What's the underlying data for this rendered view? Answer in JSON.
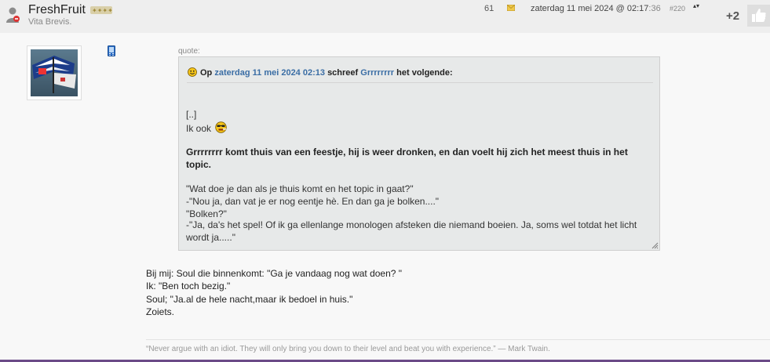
{
  "post_header": {
    "username": "FreshFruit",
    "user_title": "Vita Brevis.",
    "post_count": "61",
    "datetime": "zaterdag 11 mei 2024 @ 02:17",
    "datetime_seconds": ":36",
    "post_number": "#220",
    "score": "+2",
    "icons": {
      "user": "user-status-icon",
      "rank": "rank-stars-icon",
      "mail": "envelope-icon",
      "sort": "updown-arrows-icon",
      "like": "thumbs-up-icon"
    }
  },
  "sidebar": {
    "avatar": "avatar-flag-image",
    "device_icon": "mobile-phone-icon"
  },
  "quote": {
    "label": "quote:",
    "head_prefix": "Op",
    "head_date": "zaterdag 11 mei 2024 02:13",
    "head_middle": "schreef",
    "head_author": "Grrrrrrrr",
    "head_suffix": "het volgende:",
    "lines": {
      "ellipsis": "[..]",
      "ik_ook": "Ik ook",
      "bold": "Grrrrrrrr komt thuis van een feestje, hij is weer dronken, en dan voelt hij zich het meest thuis in het topic.",
      "l1": "\"Wat doe je dan als je thuis komt en het topic in gaat?\"",
      "l2": "-\"Nou ja, dan vat je er nog eentje hè. En dan ga je bolken....\"",
      "l3": "\"Bolken?\"",
      "l4": "-\"Ja, da's het spel! Of ik ga ellenlange monologen afsteken die niemand boeien. Ja, soms wel totdat het licht wordt ja.....\""
    }
  },
  "body": {
    "line1": "Bij mij: Soul die binnenkomt: \"Ga je vandaag nog wat doen? \"",
    "line2": "Ik: \"Ben toch bezig.\"",
    "line3": "Soul; \"Ja.al de hele nacht,maar ik bedoel in huis.\"",
    "line4": "Zoiets."
  },
  "signature": "“Never argue with an idiot. They will only bring you down to their level and beat you with experience.” — Mark Twain.",
  "colors": {
    "link": "#3b6ea5",
    "accent_bar": "#6b4a87",
    "quote_bg": "#e7e9e9"
  }
}
